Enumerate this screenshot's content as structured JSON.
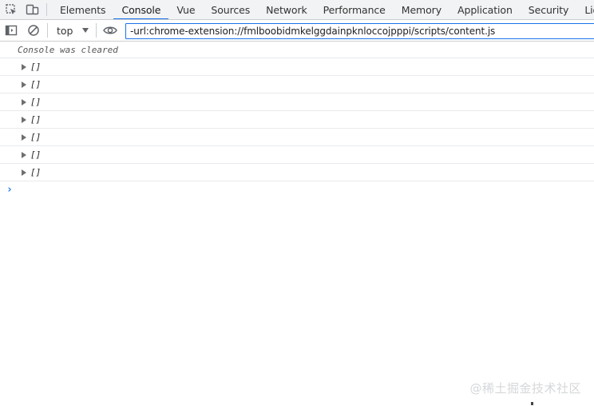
{
  "tabs": [
    {
      "label": "Elements",
      "active": false
    },
    {
      "label": "Console",
      "active": true
    },
    {
      "label": "Vue",
      "active": false
    },
    {
      "label": "Sources",
      "active": false
    },
    {
      "label": "Network",
      "active": false
    },
    {
      "label": "Performance",
      "active": false
    },
    {
      "label": "Memory",
      "active": false
    },
    {
      "label": "Application",
      "active": false
    },
    {
      "label": "Security",
      "active": false
    },
    {
      "label": "Lighth",
      "active": false
    }
  ],
  "toolbar": {
    "context": "top",
    "filter_value": "-url:chrome-extension://fmlboobidmkelggdainpknloccojpppi/scripts/content.js"
  },
  "console": {
    "cleared_message": "Console was cleared",
    "entries": [
      "[]",
      "[]",
      "[]",
      "[]",
      "[]",
      "[]",
      "[]"
    ],
    "prompt": "›"
  },
  "watermark": "@稀土掘金技术社区",
  "colors": {
    "accent": "#1a73e8",
    "tabbar_bg": "#f1f3f4",
    "border": "#cbcdd1"
  }
}
